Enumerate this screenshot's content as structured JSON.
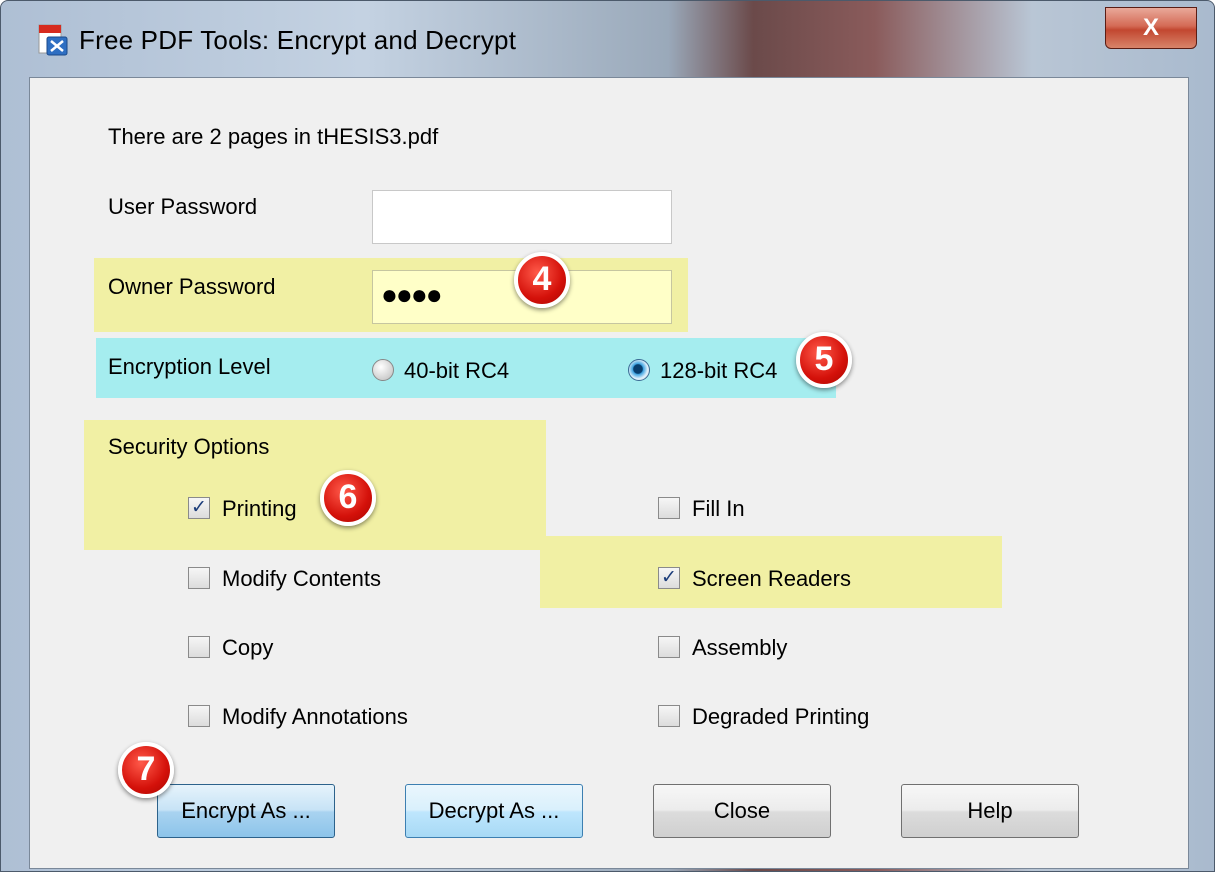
{
  "window": {
    "title": "Free PDF Tools:  Encrypt and Decrypt",
    "close_label": "X"
  },
  "info_text": "There are 2 pages in tHESIS3.pdf",
  "user_password": {
    "label": "User Password",
    "value": ""
  },
  "owner_password": {
    "label": "Owner Password",
    "value": "●●●●"
  },
  "encryption": {
    "label": "Encryption Level",
    "options": [
      {
        "label": "40-bit RC4",
        "selected": false
      },
      {
        "label": "128-bit RC4",
        "selected": true
      }
    ]
  },
  "security": {
    "label": "Security Options",
    "options": [
      {
        "label": "Printing",
        "checked": true
      },
      {
        "label": "Fill In",
        "checked": false
      },
      {
        "label": "Modify Contents",
        "checked": false
      },
      {
        "label": "Screen Readers",
        "checked": true
      },
      {
        "label": "Copy",
        "checked": false
      },
      {
        "label": "Assembly",
        "checked": false
      },
      {
        "label": "Modify Annotations",
        "checked": false
      },
      {
        "label": "Degraded Printing",
        "checked": false
      }
    ]
  },
  "buttons": {
    "encrypt": "Encrypt As ...",
    "decrypt": "Decrypt As ...",
    "close": "Close",
    "help": "Help"
  },
  "badges": [
    "4",
    "5",
    "6",
    "7"
  ],
  "colors": {
    "highlight_yellow": "#f1f0a4",
    "highlight_cyan": "#a5edef",
    "badge_red": "#d4110a"
  }
}
